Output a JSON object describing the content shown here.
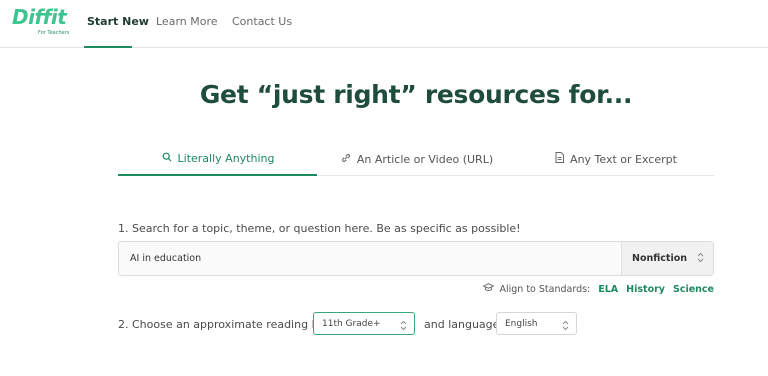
{
  "nav": {
    "logo_text": "Diffit",
    "logo_sub": "For Teachers",
    "links": [
      "Start New",
      "Learn More",
      "Contact Us"
    ],
    "active": "Start New"
  },
  "headline": "Get “just right” resources for...",
  "tabs": [
    {
      "icon": "search-icon",
      "label": "Literally Anything",
      "active": true
    },
    {
      "icon": "link-icon",
      "label": "An Article or Video (URL)",
      "active": false
    },
    {
      "icon": "document-icon",
      "label": "Any Text or Excerpt",
      "active": false
    }
  ],
  "search": {
    "prompt": "1. Search for a topic, theme, or question here. Be as specific as possible!",
    "value": "AI in education",
    "type_select": "Nonfiction"
  },
  "standards": {
    "label": "Align to Standards:",
    "options": [
      "ELA",
      "History",
      "Science"
    ]
  },
  "reading": {
    "prompt": "2. Choose an approximate reading level",
    "grade": "11th Grade+",
    "and_language": "and language",
    "language": "English"
  },
  "colors": {
    "brand_green": "#1e8a5f",
    "logo_green": "#3ec48f",
    "headline_green": "#1f4d3b"
  }
}
